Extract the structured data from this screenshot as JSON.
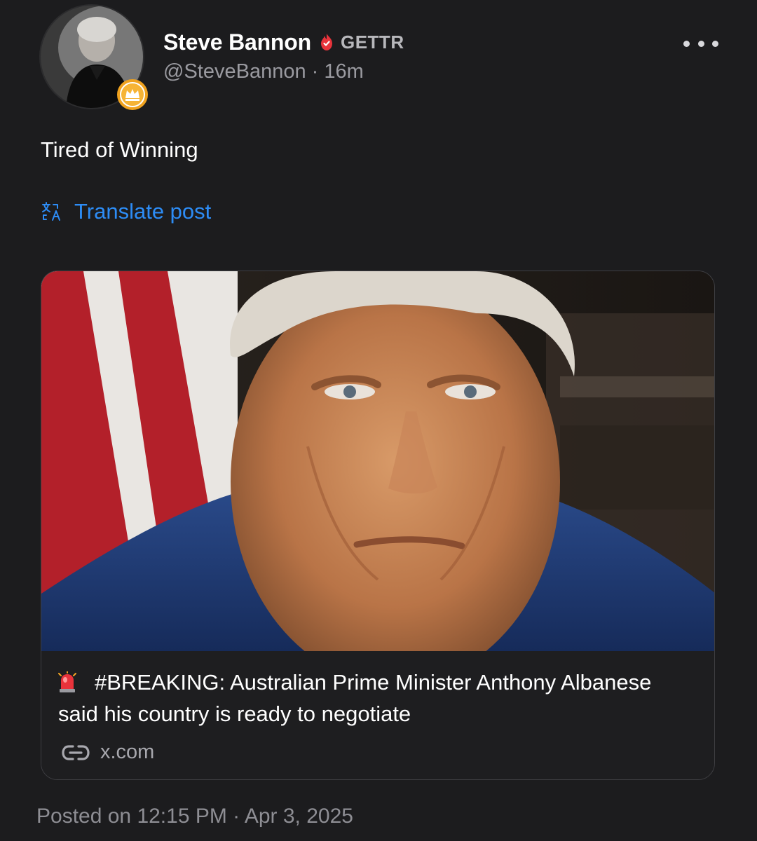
{
  "author": {
    "display_name": "Steve Bannon",
    "brand_tag": "GETTR",
    "handle": "@SteveBannon",
    "relative_time": "16m",
    "handle_line": "@SteveBannon · 16m",
    "verified_icon": "flame-verified-icon",
    "badge_icon": "crown-badge-icon"
  },
  "post": {
    "text": "Tired of Winning",
    "translate_label": "Translate post",
    "translate_icon": "translate-icon"
  },
  "link_card": {
    "headline_emoji": "siren-icon",
    "headline": "#BREAKING: Australian Prime Minister Anthony Albanese said his country is ready to negotiate",
    "domain": "x.com",
    "link_icon": "link-icon"
  },
  "footer": {
    "timestamp": "Posted on 12:15 PM · Apr 3, 2025"
  },
  "colors": {
    "background": "#1c1c1e",
    "accent_link": "#2d8cf5",
    "verified": "#e8333b",
    "badge": "#f5a623",
    "muted_text": "#9a9aa0"
  }
}
